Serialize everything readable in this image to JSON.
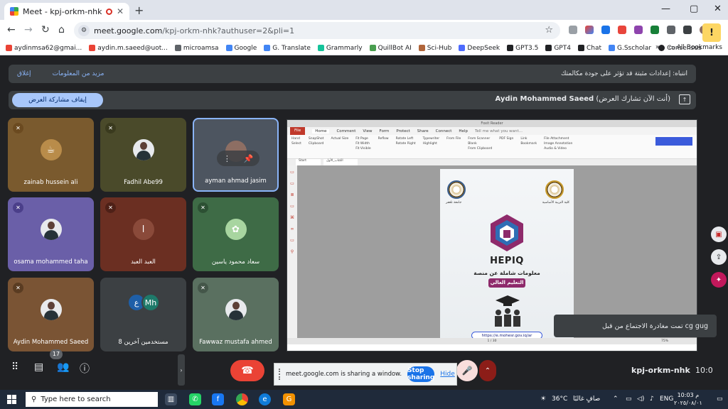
{
  "browser": {
    "tab_title": "Meet - kpj-orkm-nhk",
    "url_host": "meet.google.com",
    "url_path": "/kpj-orkm-nhk?authuser=2&pli=1",
    "bookmarks": [
      "aydinmsa62@gmai...",
      "aydin.m.saeed@uot...",
      "microamsa",
      "Google",
      "G. Translate",
      "Grammarly",
      "QuillBot AI",
      "Sci-Hub",
      "DeepSeek",
      "GPT3.5",
      "GPT4",
      "Chat",
      "G.Sscholar",
      "Consensus"
    ],
    "all_bookmarks": "All Bookmarks"
  },
  "banner": {
    "message": "انتباه: إعدادات مثبتة قد تؤثر على جودة مكالمتك",
    "more_info": "مزيد من المعلومات",
    "dismiss": "إغلاق"
  },
  "share_bar": {
    "stop_presenting": "إيقاف مشاركة العرض",
    "presenter_name": "Aydin Mohammed Saeed",
    "presenter_status": "(أنت الآن تشارك العرض)"
  },
  "participants": [
    {
      "name": "zainab hussein ali",
      "color": "#7a5a2e"
    },
    {
      "name": "Fadhil Abe99",
      "color": "#4a4a2a"
    },
    {
      "name": "ayman ahmad jasim",
      "color": "#4d5560"
    },
    {
      "name": "osama mohammed taha",
      "color": "#6a5fa8"
    },
    {
      "name": "العبد العبد",
      "initial": "ا",
      "color": "#6b2f22"
    },
    {
      "name": "سعاد محمود ياسين",
      "color": "#3e6b46"
    },
    {
      "name": "Aydin Mohammed Saeed",
      "color": "#7a5434"
    },
    {
      "name": "8 مستخدمين آخرين",
      "others": [
        "ع",
        "Mh"
      ],
      "color": "#3c4043"
    },
    {
      "name": "Fawwaz mustafa ahmed",
      "color": "#5a7060"
    }
  ],
  "presentation": {
    "app_menu": [
      "File",
      "Home",
      "Comment",
      "View",
      "Form",
      "Protect",
      "Share",
      "Connect",
      "Help"
    ],
    "app_hint": "Tell me what you want...",
    "ribbon": [
      "Hand",
      "Select",
      "SnapShot",
      "Clipboard",
      "Actual Size",
      "Fit Page",
      "Fit Width",
      "Fit Visible",
      "Reflow",
      "Rotate Left",
      "Rotate Right",
      "Typewriter",
      "Highlight",
      "From File",
      "From Scanner",
      "Blank",
      "From Clipboard",
      "PDF Sign",
      "Link",
      "Bookmark",
      "File Attachment",
      "Image Annotation",
      "Audio & Video"
    ],
    "doc_tabs": [
      "Start",
      "الكتاب_الأول"
    ],
    "seal_left_caption": "جامعة تلعفر",
    "seal_right_caption": "كلية التربية الأساسية",
    "brand": "HEPIQ",
    "tagline": "معلومات شاملة عن منصة",
    "tagline_highlight": "التعليم العالي",
    "link": "https://e.mohesr.gov.iq/ar",
    "page_counter": "1 / 30",
    "zoom": "75%"
  },
  "toast": "تمت مغادرة الاجتماع من قبل cg gug",
  "controls": {
    "participant_count": "17",
    "meeting_code": "kpj-orkm-nhk",
    "time": "10:0"
  },
  "sharing_bar": {
    "message": "meet.google.com is sharing a window.",
    "stop": "Stop sharing",
    "hide": "Hide"
  },
  "taskbar": {
    "search_placeholder": "Type here to search",
    "weather": "36°C",
    "weather_desc": "صافٍ غالبًا",
    "lang": "ENG",
    "time": "10:03 م",
    "date": "٢٠٢٥/٠٨/٠١"
  }
}
